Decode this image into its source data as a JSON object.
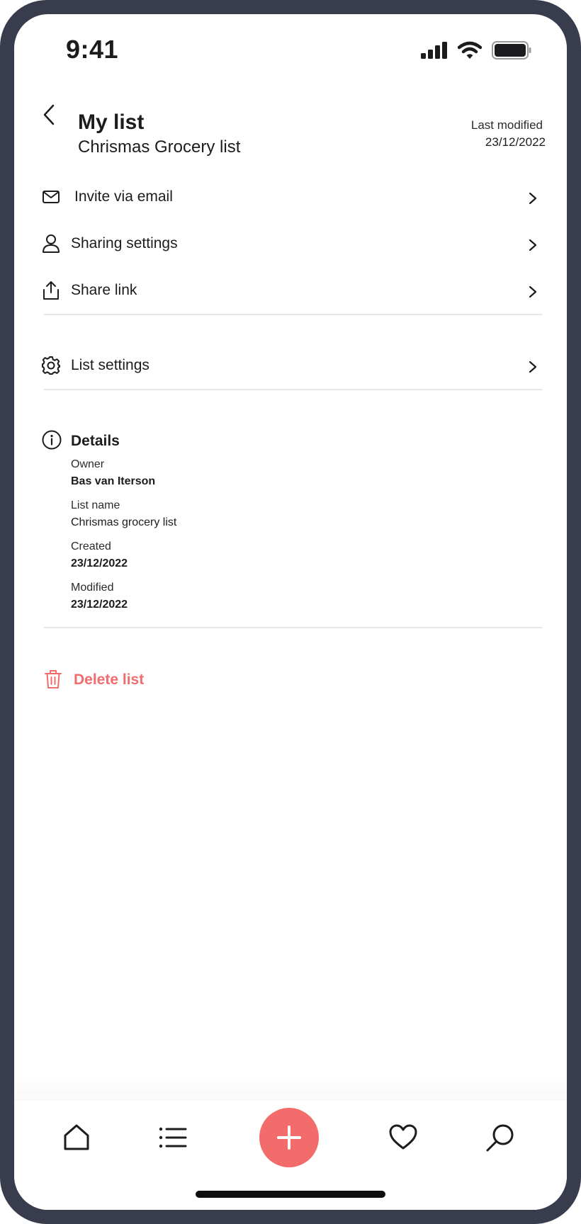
{
  "status_bar": {
    "time": "9:41"
  },
  "header": {
    "title": "My list",
    "subtitle": "Chrismas Grocery list",
    "last_modified_label": "Last modified",
    "last_modified_date": "23/12/2022"
  },
  "menu": {
    "invite": "Invite via email",
    "sharing": "Sharing settings",
    "share_link": "Share link",
    "list_settings": "List settings"
  },
  "details": {
    "title": "Details",
    "owner_label": "Owner",
    "owner_value": "Bas van Iterson",
    "list_name_label": "List name",
    "list_name_value": "Chrismas grocery list",
    "created_label": "Created",
    "created_value": "23/12/2022",
    "modified_label": "Modified",
    "modified_value": "23/12/2022"
  },
  "delete_label": "Delete list",
  "colors": {
    "accent": "#f26c6c",
    "frame": "#383c4c",
    "text": "#1c1c1e",
    "divider": "#e6e6e9"
  },
  "icons": [
    "back-icon",
    "mail-icon",
    "user-icon",
    "share-icon",
    "gear-icon",
    "info-icon",
    "trash-icon",
    "home-icon",
    "list-icon",
    "plus-icon",
    "heart-icon",
    "search-icon"
  ]
}
